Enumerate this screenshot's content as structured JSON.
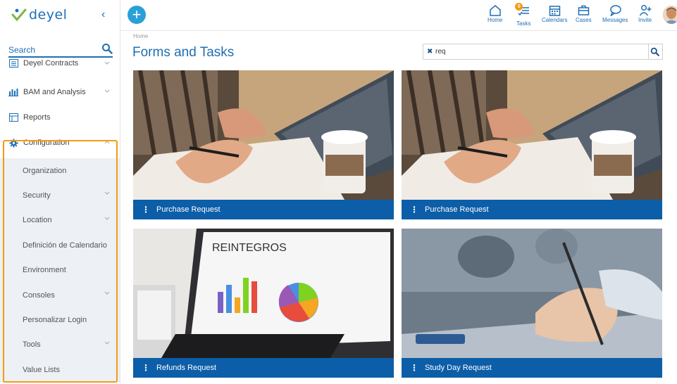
{
  "logo": {
    "text": "deyel"
  },
  "sidebar": {
    "search_label": "Search",
    "items": [
      {
        "label": "Deyel Contracts"
      },
      {
        "label": "BAM and Analysis"
      },
      {
        "label": "Reports"
      },
      {
        "label": "Configuration"
      }
    ],
    "config_subitems": [
      {
        "label": "Organization"
      },
      {
        "label": "Security"
      },
      {
        "label": "Location"
      },
      {
        "label": "Definición de Calendario"
      },
      {
        "label": "Environment"
      },
      {
        "label": "Consoles"
      },
      {
        "label": "Personalizar Login"
      },
      {
        "label": "Tools"
      },
      {
        "label": "Value Lists"
      }
    ]
  },
  "topbar": {
    "nav": [
      {
        "label": "Home",
        "icon": "home-icon"
      },
      {
        "label": "Tasks",
        "icon": "tasks-icon",
        "badge": "0"
      },
      {
        "label": "Calendars",
        "icon": "calendar-icon"
      },
      {
        "label": "Cases",
        "icon": "briefcase-icon"
      },
      {
        "label": "Messages",
        "icon": "message-icon"
      },
      {
        "label": "Invite",
        "icon": "invite-icon"
      }
    ]
  },
  "main": {
    "breadcrumb": "Home",
    "title": "Forms and Tasks",
    "filter_value": "req",
    "cards": [
      {
        "title": "Purchase Request"
      },
      {
        "title": "Purchase Request"
      },
      {
        "title": "Refunds Request",
        "image_text": "REINTEGROS"
      },
      {
        "title": "Study Day Request"
      }
    ]
  },
  "colors": {
    "accent": "#1e6fb4",
    "card_bar": "#0c5ea8",
    "highlight": "#f39c12",
    "add_button": "#2aa0d8"
  }
}
